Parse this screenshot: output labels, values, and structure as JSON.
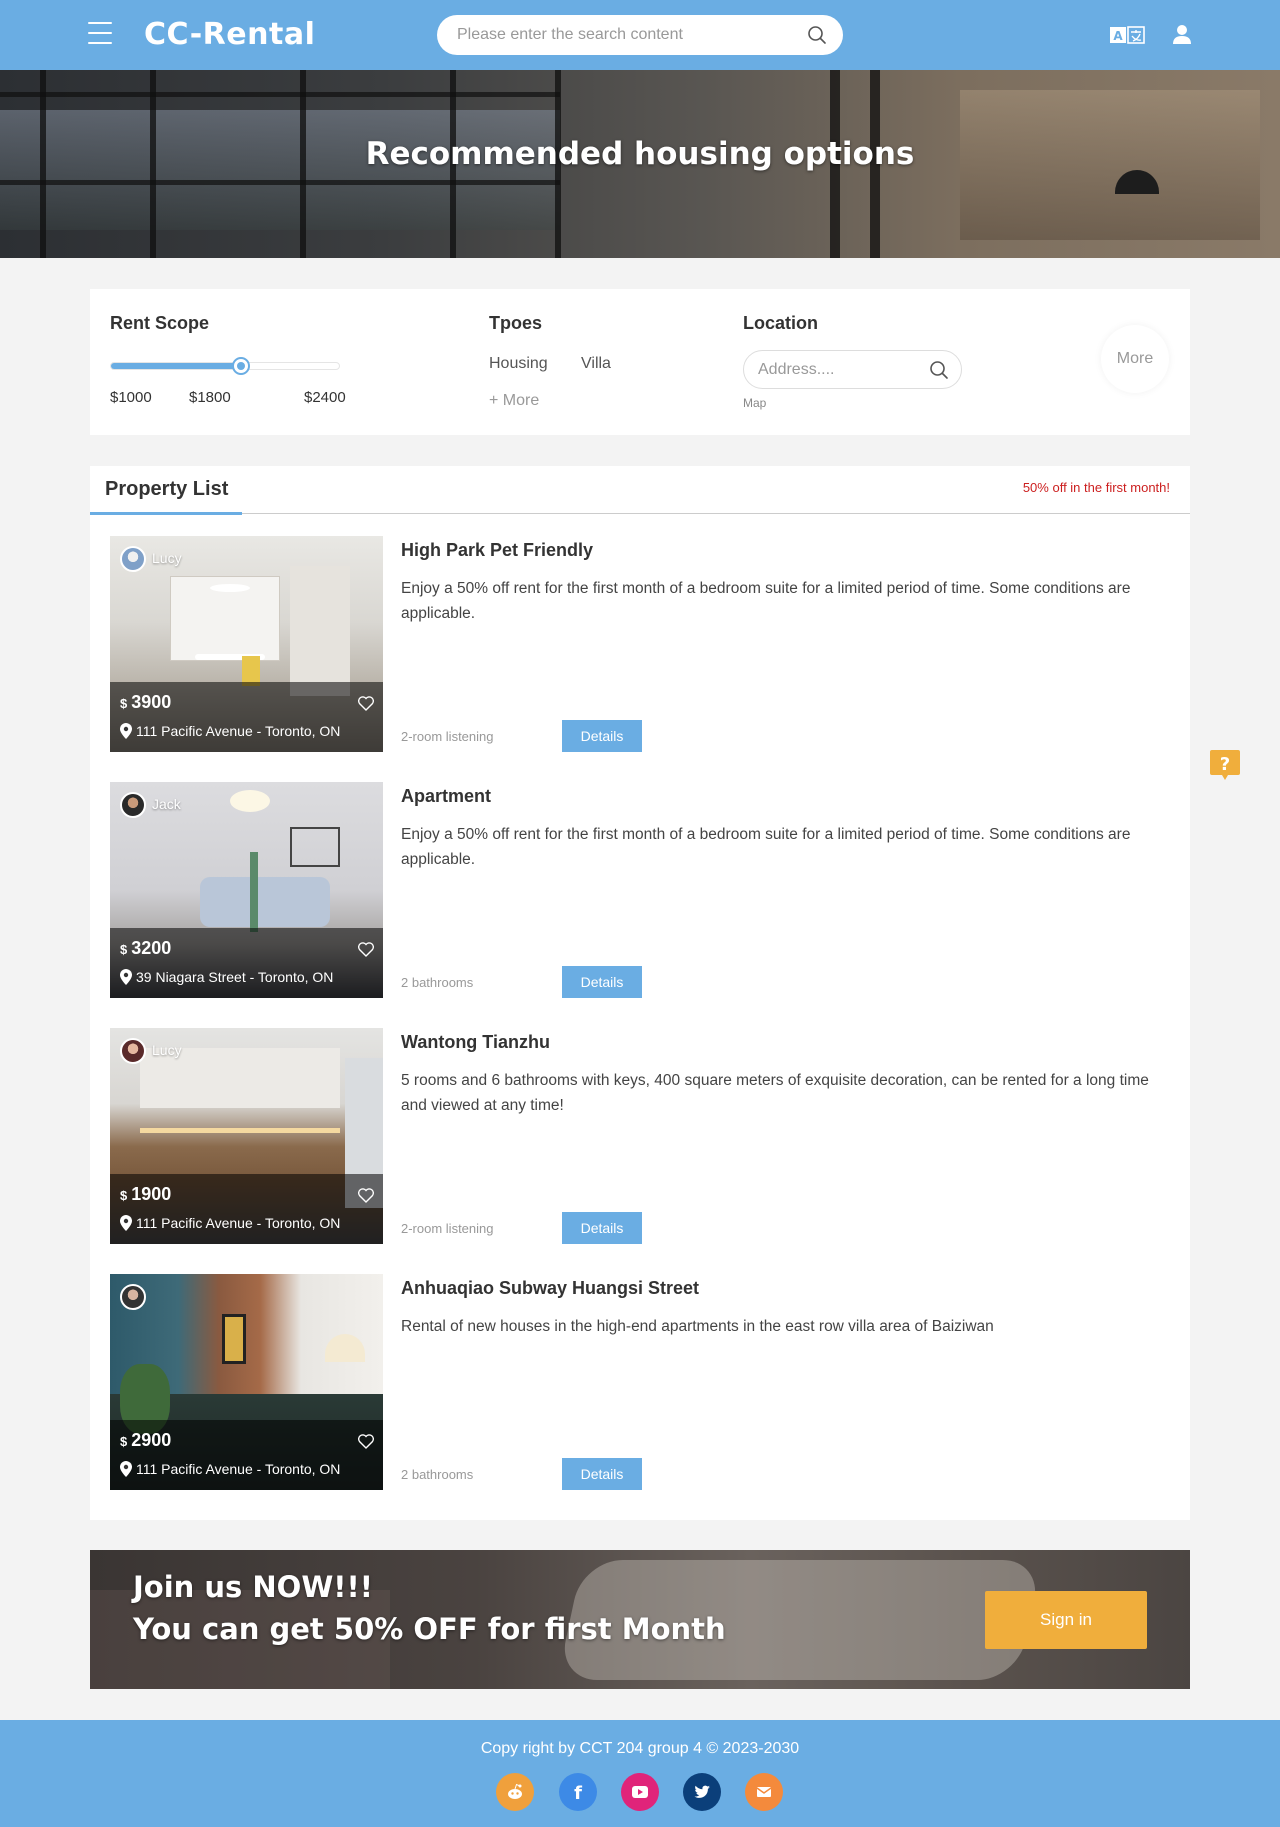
{
  "header": {
    "brand": "CC-Rental",
    "search_placeholder": "Please enter the search content"
  },
  "hero": {
    "title": "Recommended housing options"
  },
  "filters": {
    "rent_scope": {
      "title": "Rent Scope",
      "min": 1000,
      "max": 2400,
      "value": 1800,
      "ticks": [
        "$1000",
        "$1800",
        "$2400"
      ]
    },
    "types": {
      "title": "Tpoes",
      "options": [
        "Housing",
        "Villa"
      ],
      "more": "+ More"
    },
    "location": {
      "title": "Location",
      "address_placeholder": "Address....",
      "map": "Map"
    },
    "more_button": "More"
  },
  "property_list": {
    "title": "Property List",
    "promo": "50% off in the first month!",
    "details_label": "Details",
    "currency": "$",
    "items": [
      {
        "agent": "Lucy",
        "price": "3900",
        "address": "111 Pacific Avenue - Toronto, ON",
        "title": "High Park Pet Friendly",
        "description": "Enjoy a 50% off rent for the first month of a bedroom suite for a limited period of time. Some conditions are applicable.",
        "tag": "2-room listening"
      },
      {
        "agent": "Jack",
        "price": "3200",
        "address": "39 Niagara Street - Toronto, ON",
        "title": "Apartment",
        "description": "Enjoy a 50% off rent for the first month of a bedroom suite for a limited period of time. Some conditions are applicable.",
        "tag": "2 bathrooms"
      },
      {
        "agent": "Lucy",
        "price": "1900",
        "address": "111 Pacific Avenue - Toronto, ON",
        "title": "Wantong Tianzhu",
        "description": "5 rooms and 6 bathrooms with keys, 400 square meters of exquisite decoration, can be rented for a long time and viewed at any time!",
        "tag": "2-room listening"
      },
      {
        "agent": "",
        "price": "2900",
        "address": "111 Pacific Avenue - Toronto, ON",
        "title": "Anhuaqiao Subway Huangsi Street",
        "description": "Rental of new houses in the high-end apartments in the east row villa area of Baiziwan",
        "tag": "2 bathrooms"
      }
    ]
  },
  "join": {
    "line1": "Join us NOW!!!",
    "line2": "You can get 50% OFF for first Month",
    "signin": "Sign in"
  },
  "footer": {
    "copyright": "Copy right by CCT 204 group 4 © 2023-2030",
    "social": [
      {
        "icon": "reddit-icon",
        "color": "#f0a03c"
      },
      {
        "icon": "facebook-icon",
        "color": "#3d8ae6"
      },
      {
        "icon": "youtube-icon",
        "color": "#e0247a"
      },
      {
        "icon": "twitter-icon",
        "color": "#0b3f7a"
      },
      {
        "icon": "email-icon",
        "color": "#f48a3c"
      }
    ]
  },
  "colors": {
    "primary": "#6aade3",
    "accent": "#f0ae3c",
    "promo": "#cc1f1f",
    "help": "#f0ae3c"
  }
}
